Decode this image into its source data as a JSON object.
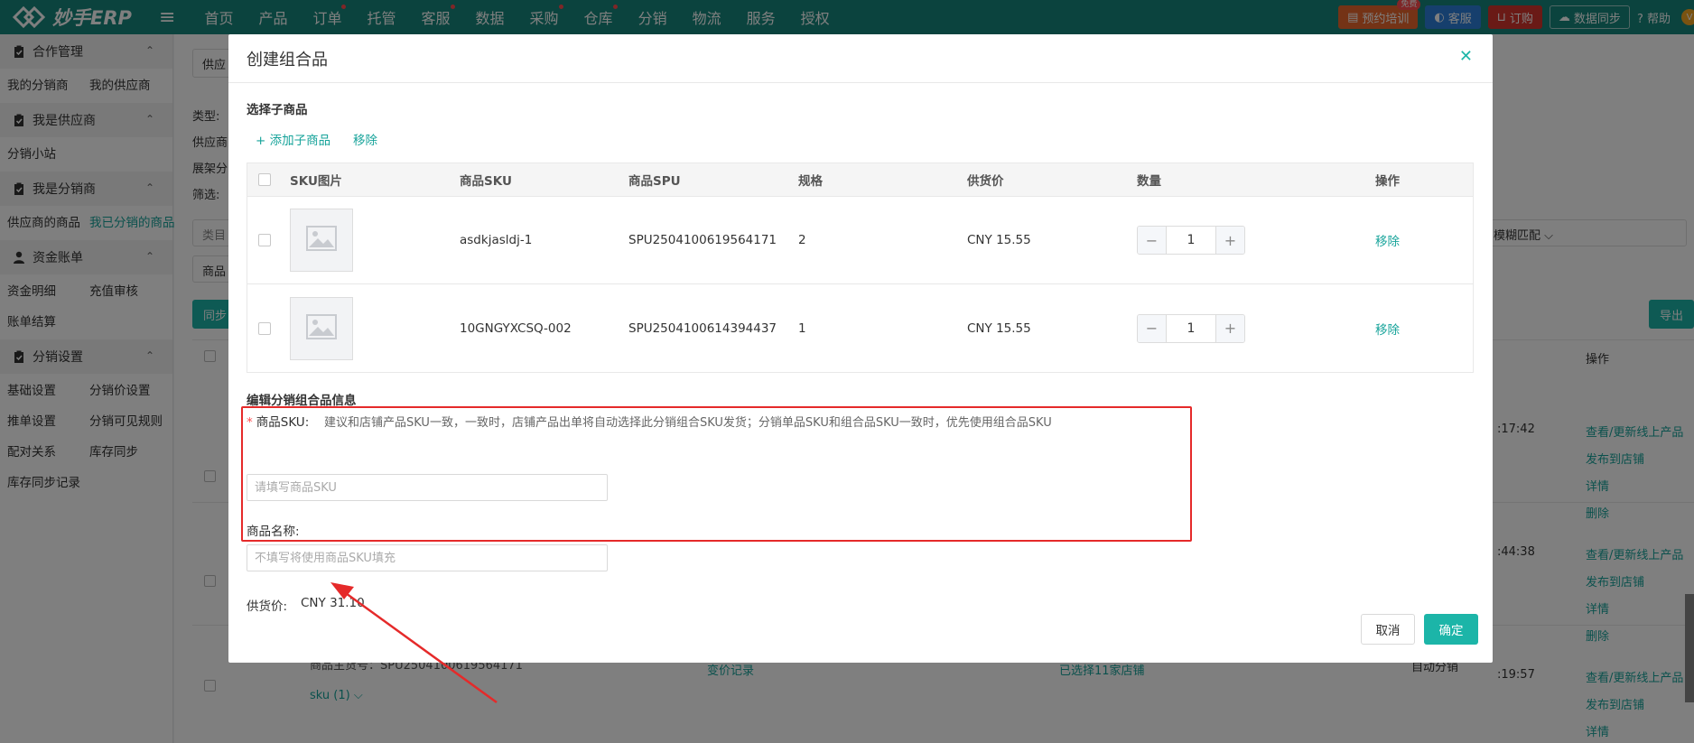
{
  "app": {
    "logo_text": "妙手ERP"
  },
  "topnav": {
    "items": [
      {
        "label": "首页",
        "dot": false
      },
      {
        "label": "产品",
        "dot": false
      },
      {
        "label": "订单",
        "dot": true
      },
      {
        "label": "托管",
        "dot": false
      },
      {
        "label": "客服",
        "dot": true
      },
      {
        "label": "数据",
        "dot": false
      },
      {
        "label": "采购",
        "dot": true
      },
      {
        "label": "仓库",
        "dot": true
      },
      {
        "label": "分销",
        "dot": false
      },
      {
        "label": "物流",
        "dot": false
      },
      {
        "label": "服务",
        "dot": false
      },
      {
        "label": "授权",
        "dot": false
      }
    ],
    "training": "预约培训",
    "training_badge": "免费",
    "service": "客服",
    "subscribe": "订购",
    "data_sync": "数据同步",
    "help": "帮助",
    "avatar": "V"
  },
  "sidebar": {
    "sections": [
      {
        "title": "合作管理",
        "items": [
          "我的分销商",
          "我的供应商"
        ]
      },
      {
        "title": "我是供应商",
        "items": [
          "分销小站"
        ]
      },
      {
        "title": "我是分销商",
        "items": [
          "供应商的商品",
          "我已分销的商品"
        ]
      },
      {
        "title": "资金账单",
        "items": [
          "资金明细",
          "充值审核",
          "账单结算"
        ]
      },
      {
        "title": "分销设置",
        "items": [
          "基础设置",
          "分销价设置",
          "推单设置",
          "分销可见规则",
          "配对关系",
          "库存同步",
          "库存同步记录"
        ]
      }
    ],
    "active_item": "我已分销的商品"
  },
  "background": {
    "supplier_tab": "供应",
    "filter_labels": [
      "类型:",
      "供应商",
      "展架分",
      "筛选:"
    ],
    "category_placeholder": "类目",
    "product_label": "商品",
    "match_mode": "模糊匹配",
    "sync_button": "同步",
    "export_button": "导出",
    "col_action": "操作",
    "times": [
      ":17:42",
      ":44:38",
      ":19:57"
    ],
    "row_actions": [
      "查看/更新线上产品",
      "发布到店铺",
      "详情",
      "删除"
    ],
    "product_spu_line": "商品主货号：SPU2504100619564171",
    "sku_count": "sku (1)",
    "price_change_link": "变价记录",
    "shops_selected": "已选择11家店铺",
    "auto_distribute": "自动分销"
  },
  "modal": {
    "title": "创建组合品",
    "select_section": "选择子商品",
    "add_link": "添加子商品",
    "remove_link": "移除",
    "table": {
      "headers": [
        "SKU图片",
        "商品SKU",
        "商品SPU",
        "规格",
        "供货价",
        "数量",
        "操作"
      ],
      "rows": [
        {
          "sku": "asdkjasldj-1",
          "spu": "SPU2504100619564171",
          "spec": "2",
          "price": "CNY 15.55",
          "qty": "1",
          "action": "移除"
        },
        {
          "sku": "10GNGYXCSQ-002",
          "spu": "SPU2504100614394437",
          "spec": "1",
          "price": "CNY 15.55",
          "qty": "1",
          "action": "移除"
        }
      ]
    },
    "edit_section": "编辑分销组合品信息",
    "sku_label": "商品SKU:",
    "sku_hint": "建议和店铺产品SKU一致，一致时，店铺产品出单将自动选择此分销组合SKU发货；分销单品SKU和组合品SKU一致时，优先使用组合品SKU",
    "sku_placeholder": "请填写商品SKU",
    "name_label": "商品名称:",
    "name_placeholder": "不填写将使用商品SKU填充",
    "price_label": "供货价:",
    "price_value": "CNY 31.10",
    "cancel": "取消",
    "confirm": "确定"
  },
  "colors": {
    "primary": "#1cb5a8",
    "nav": "#16877c",
    "highlight": "#e52a2a"
  }
}
